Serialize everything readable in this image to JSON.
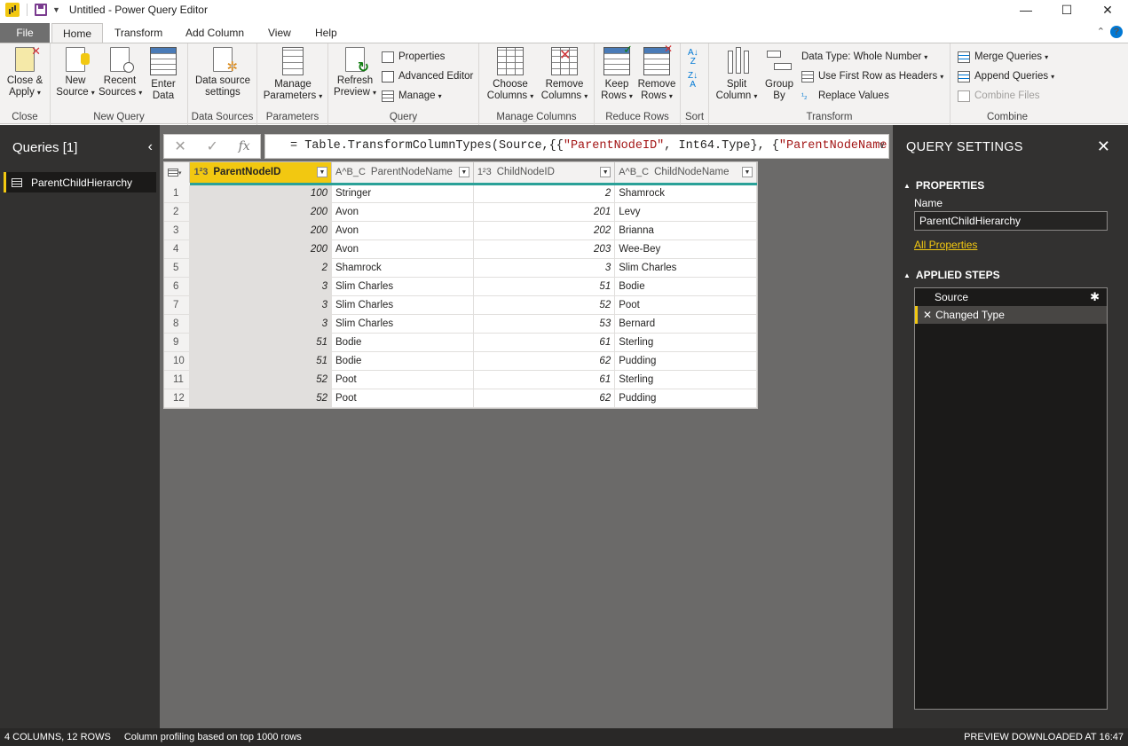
{
  "titlebar": {
    "title": "Untitled - Power Query Editor",
    "minimize": "—",
    "maximize": "☐",
    "close": "✕"
  },
  "tabs": [
    "File",
    "Home",
    "Transform",
    "Add Column",
    "View",
    "Help"
  ],
  "tabs_right": {
    "collapse": "⌃",
    "help": "?"
  },
  "ribbon": {
    "close_group": {
      "label": "Close",
      "close_apply": "Close &",
      "close_apply2": "Apply"
    },
    "new_query": {
      "label": "New Query",
      "new_source": "New",
      "new_source2": "Source",
      "recent": "Recent",
      "recent2": "Sources",
      "enter": "Enter",
      "enter2": "Data"
    },
    "data_sources": {
      "label": "Data Sources",
      "settings": "Data source",
      "settings2": "settings"
    },
    "parameters": {
      "label": "Parameters",
      "manage": "Manage",
      "manage2": "Parameters"
    },
    "query": {
      "label": "Query",
      "refresh": "Refresh",
      "refresh2": "Preview",
      "properties": "Properties",
      "advanced": "Advanced Editor",
      "manage": "Manage"
    },
    "manage_columns": {
      "label": "Manage Columns",
      "choose": "Choose",
      "choose2": "Columns",
      "remove": "Remove",
      "remove2": "Columns"
    },
    "reduce_rows": {
      "label": "Reduce Rows",
      "keep": "Keep",
      "keep2": "Rows",
      "remove": "Remove",
      "remove2": "Rows"
    },
    "sort": {
      "label": "Sort"
    },
    "transform": {
      "label": "Transform",
      "split": "Split",
      "split2": "Column",
      "group": "Group",
      "group2": "By",
      "datatype": "Data Type: Whole Number",
      "first_row": "Use First Row as Headers",
      "replace": "Replace Values"
    },
    "combine": {
      "label": "Combine",
      "merge": "Merge Queries",
      "append": "Append Queries",
      "combine_files": "Combine Files"
    }
  },
  "queries_pane": {
    "title": "Queries [1]",
    "items": [
      {
        "label": "ParentChildHierarchy"
      }
    ]
  },
  "formula_bar": {
    "cancel": "✕",
    "commit": "✓",
    "fx": "fx",
    "prefix": "= Table.TransformColumnTypes(Source,{{",
    "s1": "\"ParentNodeID\"",
    "mid": ", Int64.Type}, {",
    "s2": "\"ParentNodeName\"",
    "suffix": ",",
    "expand": "∨"
  },
  "table": {
    "columns": [
      {
        "type": "1²3",
        "name": "ParentNodeID"
      },
      {
        "type": "A^B_C",
        "name": "ParentNodeName"
      },
      {
        "type": "1²3",
        "name": "ChildNodeID"
      },
      {
        "type": "A^B_C",
        "name": "ChildNodeName"
      }
    ],
    "rows": [
      [
        "1",
        "100",
        "Stringer",
        "2",
        "Shamrock"
      ],
      [
        "2",
        "200",
        "Avon",
        "201",
        "Levy"
      ],
      [
        "3",
        "200",
        "Avon",
        "202",
        "Brianna"
      ],
      [
        "4",
        "200",
        "Avon",
        "203",
        "Wee-Bey"
      ],
      [
        "5",
        "2",
        "Shamrock",
        "3",
        "Slim Charles"
      ],
      [
        "6",
        "3",
        "Slim Charles",
        "51",
        "Bodie"
      ],
      [
        "7",
        "3",
        "Slim Charles",
        "52",
        "Poot"
      ],
      [
        "8",
        "3",
        "Slim Charles",
        "53",
        "Bernard"
      ],
      [
        "9",
        "51",
        "Bodie",
        "61",
        "Sterling"
      ],
      [
        "10",
        "51",
        "Bodie",
        "62",
        "Pudding"
      ],
      [
        "11",
        "52",
        "Poot",
        "61",
        "Sterling"
      ],
      [
        "12",
        "52",
        "Poot",
        "62",
        "Pudding"
      ]
    ]
  },
  "settings": {
    "title": "QUERY SETTINGS",
    "properties": "PROPERTIES",
    "name_label": "Name",
    "name_value": "ParentChildHierarchy",
    "all_props": "All Properties",
    "applied_steps": "APPLIED STEPS",
    "steps": [
      {
        "label": "Source"
      },
      {
        "label": "Changed Type"
      }
    ]
  },
  "status": {
    "columns_rows": "4 COLUMNS, 12 ROWS",
    "profiling": "Column profiling based on top 1000 rows",
    "preview": "PREVIEW DOWNLOADED AT 16:47"
  },
  "colors": {
    "accent": "#f2c811",
    "pane_bg": "#323130",
    "grid_bg": "#6b6a69",
    "header_underline": "#2aa198"
  }
}
